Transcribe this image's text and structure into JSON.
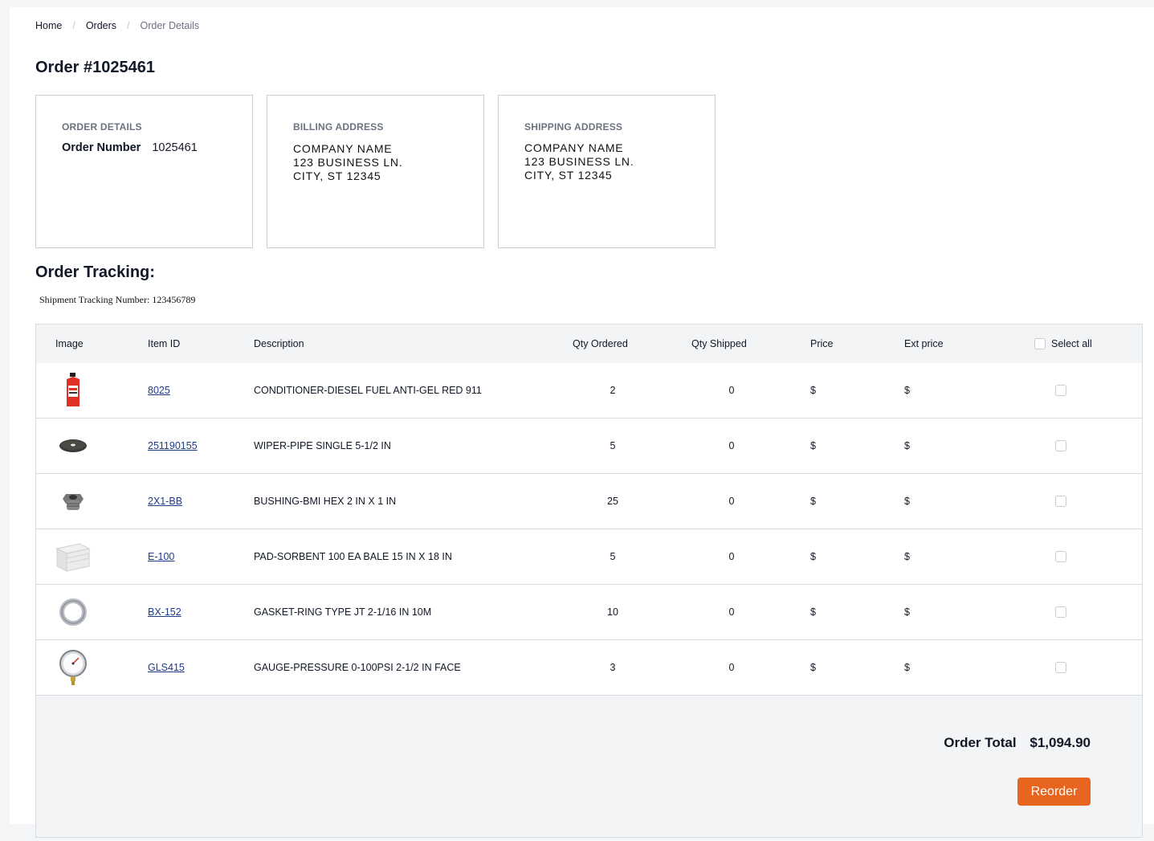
{
  "breadcrumb": {
    "home": "Home",
    "orders": "Orders",
    "current": "Order Details",
    "separator": "/"
  },
  "order": {
    "title": "Order #1025461"
  },
  "cards": {
    "details": {
      "title": "ORDER DETAILS",
      "number_label": "Order Number",
      "number_value": "1025461"
    },
    "billing": {
      "title": "BILLING ADDRESS",
      "lines": [
        "COMPANY NAME",
        "123 BUSINESS LN.",
        "CITY, ST 12345"
      ]
    },
    "shipping": {
      "title": "SHIPPING ADDRESS",
      "lines": [
        "COMPANY NAME",
        "123 BUSINESS LN.",
        "CITY, ST 12345"
      ]
    }
  },
  "tracking": {
    "title": "Order Tracking:",
    "label": "Shipment Tracking Number:",
    "number": "123456789"
  },
  "table": {
    "headers": {
      "image": "Image",
      "item_id": "Item ID",
      "description": "Description",
      "qty_ordered": "Qty Ordered",
      "qty_shipped": "Qty Shipped",
      "price": "Price",
      "ext_price": "Ext price",
      "select_all": "Select all"
    },
    "rows": [
      {
        "image": "diesel-conditioner-bottle-icon",
        "item_id": "8025",
        "description": "CONDITIONER-DIESEL FUEL ANTI-GEL RED 911",
        "qty_ordered": "2",
        "qty_shipped": "0",
        "price": "$",
        "ext_price": "$"
      },
      {
        "image": "pipe-wiper-icon",
        "item_id": "251190155",
        "description": "WIPER-PIPE SINGLE 5-1/2 IN",
        "qty_ordered": "5",
        "qty_shipped": "0",
        "price": "$",
        "ext_price": "$"
      },
      {
        "image": "hex-bushing-icon",
        "item_id": "2X1-BB",
        "description": "BUSHING-BMI HEX 2 IN X 1 IN",
        "qty_ordered": "25",
        "qty_shipped": "0",
        "price": "$",
        "ext_price": "$"
      },
      {
        "image": "sorbent-pad-icon",
        "item_id": "E-100",
        "description": "PAD-SORBENT 100 EA BALE 15 IN X 18 IN",
        "qty_ordered": "5",
        "qty_shipped": "0",
        "price": "$",
        "ext_price": "$"
      },
      {
        "image": "ring-gasket-icon",
        "item_id": "BX-152",
        "description": "GASKET-RING TYPE JT 2-1/16 IN 10M",
        "qty_ordered": "10",
        "qty_shipped": "0",
        "price": "$",
        "ext_price": "$"
      },
      {
        "image": "pressure-gauge-icon",
        "item_id": "GLS415",
        "description": "GAUGE-PRESSURE 0-100PSI 2-1/2 IN FACE",
        "qty_ordered": "3",
        "qty_shipped": "0",
        "price": "$",
        "ext_price": "$"
      }
    ]
  },
  "summary": {
    "total_label": "Order Total",
    "total_value": "$1,094.90",
    "reorder_label": "Reorder"
  },
  "colors": {
    "accent": "#e8651f",
    "link": "#1e3a8a",
    "border": "#c9ccd1",
    "page_bg": "#f4f5f7"
  }
}
